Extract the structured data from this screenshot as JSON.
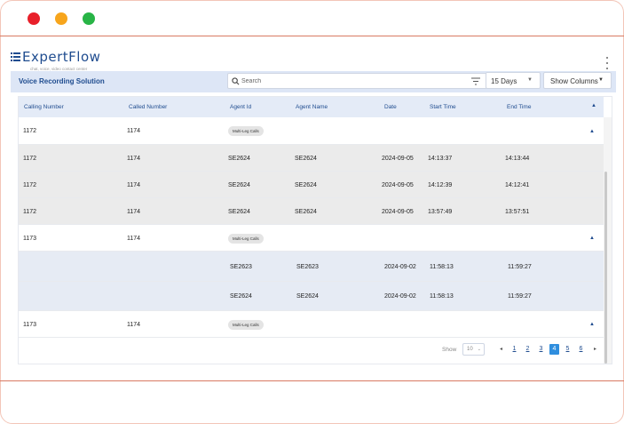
{
  "window": {
    "controls": [
      "close",
      "minimize",
      "maximize"
    ]
  },
  "brand": {
    "name": "ExpertFlow",
    "tagline": "chat, voice, video contact center",
    "color": "#1f4c8f"
  },
  "toolbar": {
    "title": "Voice Recording Solution",
    "search_placeholder": "Search",
    "days_label": "15 Days",
    "columns_label": "Show Columns"
  },
  "table": {
    "headers": [
      "Calling Number",
      "Called Number",
      "Agent Id",
      "Agent Name",
      "Date",
      "Start Time",
      "End Time"
    ],
    "rows": [
      {
        "type": "parent",
        "calling": "1172",
        "called": "1174",
        "badge": "Multi-Leg Calls"
      },
      {
        "type": "child",
        "calling": "1172",
        "called": "1174",
        "agent_id": "SE2624",
        "agent_name": "SE2624",
        "date": "2024-09-05",
        "start": "14:13:37",
        "end": "14:13:44"
      },
      {
        "type": "child",
        "calling": "1172",
        "called": "1174",
        "agent_id": "SE2624",
        "agent_name": "SE2624",
        "date": "2024-09-05",
        "start": "14:12:39",
        "end": "14:12:41"
      },
      {
        "type": "child",
        "calling": "1172",
        "called": "1174",
        "agent_id": "SE2624",
        "agent_name": "SE2624",
        "date": "2024-09-05",
        "start": "13:57:49",
        "end": "13:57:51"
      },
      {
        "type": "parent",
        "calling": "1173",
        "called": "1174",
        "badge": "Multi-Leg Calls"
      },
      {
        "type": "child",
        "calling": "",
        "called": "",
        "agent_id": "SE2623",
        "agent_name": "SE2623",
        "date": "2024-09-02",
        "start": "11:58:13",
        "end": "11:59:27"
      },
      {
        "type": "child",
        "calling": "",
        "called": "",
        "agent_id": "SE2624",
        "agent_name": "SE2624",
        "date": "2024-09-02",
        "start": "11:58:13",
        "end": "11:59:27"
      },
      {
        "type": "parent",
        "calling": "1173",
        "called": "1174",
        "badge": "Multi-Leg Calls"
      }
    ]
  },
  "pagination": {
    "show_label": "Show",
    "page_size": "10",
    "pages": [
      "1",
      "2",
      "3",
      "4",
      "5",
      "6"
    ],
    "current_page": "4",
    "active_color": "#2f8ede"
  }
}
